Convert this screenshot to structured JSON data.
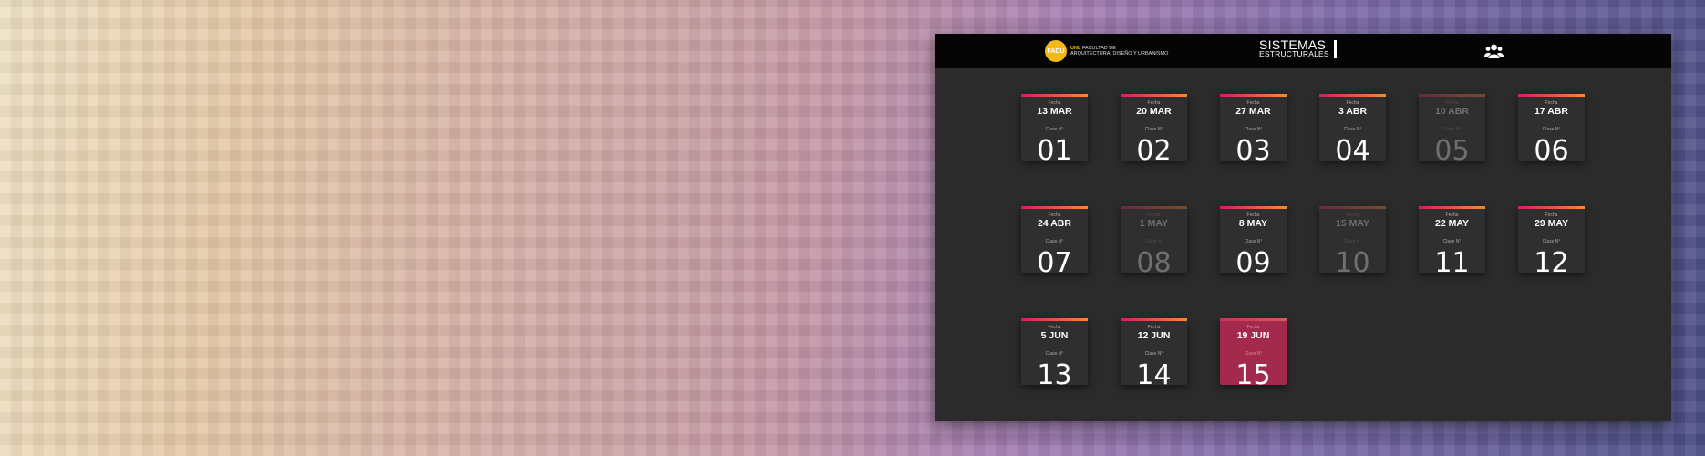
{
  "header": {
    "logo_text": "FADU",
    "university": "UNL",
    "faculty_line1": "FACULTAD DE",
    "faculty_line2": "ARQUITECTURA, DISEÑO Y URBANISMO",
    "title_line1": "SISTEMAS",
    "title_line2": "ESTRUCTURALES",
    "user_icon": "users-icon"
  },
  "labels": {
    "fecha": "Fecha",
    "clase": "Clase N°"
  },
  "colors": {
    "accent_start": "#d21f5f",
    "accent_end": "#f28c2b",
    "active": "#a32a4d",
    "panel": "#2b2b2b",
    "topbar": "#050505",
    "logo": "#f4b915"
  },
  "classes": [
    {
      "date": "13 MAR",
      "number": "01",
      "state": "normal"
    },
    {
      "date": "20 MAR",
      "number": "02",
      "state": "normal"
    },
    {
      "date": "27 MAR",
      "number": "03",
      "state": "normal"
    },
    {
      "date": "3 ABR",
      "number": "04",
      "state": "normal"
    },
    {
      "date": "10 ABR",
      "number": "05",
      "state": "dim"
    },
    {
      "date": "17 ABR",
      "number": "06",
      "state": "normal"
    },
    {
      "date": "24 ABR",
      "number": "07",
      "state": "normal"
    },
    {
      "date": "1 MAY",
      "number": "08",
      "state": "dim"
    },
    {
      "date": "8 MAY",
      "number": "09",
      "state": "normal"
    },
    {
      "date": "15 MAY",
      "number": "10",
      "state": "dim"
    },
    {
      "date": "22 MAY",
      "number": "11",
      "state": "normal"
    },
    {
      "date": "29 MAY",
      "number": "12",
      "state": "normal"
    },
    {
      "date": "5 JUN",
      "number": "13",
      "state": "normal"
    },
    {
      "date": "12 JUN",
      "number": "14",
      "state": "normal"
    },
    {
      "date": "19 JUN",
      "number": "15",
      "state": "active"
    }
  ]
}
